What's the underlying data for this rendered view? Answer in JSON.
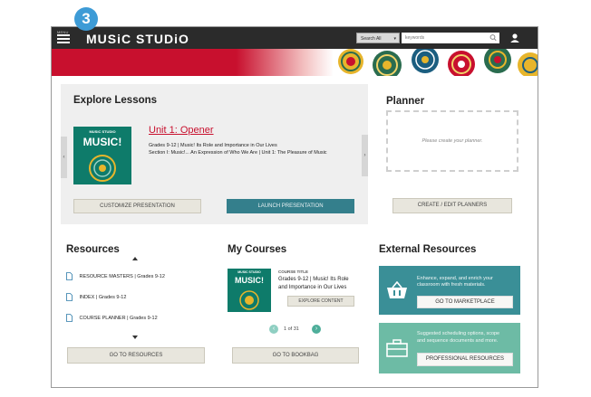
{
  "step_badge": "3",
  "header": {
    "menu_tiny_label": "MENU",
    "logo_text": "MUSiC STUDiO",
    "search_scope": "Search All",
    "search_placeholder": "keywords"
  },
  "explore": {
    "title": "Explore Lessons",
    "cover": {
      "brand": "MUSIC STUDIO",
      "title": "MUSIC!"
    },
    "unit_title": "Unit 1: Opener",
    "line1": "Grades 9-12 | Music! Its Role and Importance in Our Lives",
    "line2": "Section I: Music!... An Expression of Who We Are | Unit 1: The Pleasure of Music",
    "customize_label": "CUSTOMIZE PRESENTATION",
    "launch_label": "LAUNCH PRESENTATION",
    "prev_glyph": "‹",
    "next_glyph": "›"
  },
  "planner": {
    "title": "Planner",
    "placeholder": "Please create your planner.",
    "create_label": "CREATE / EDIT PLANNERS"
  },
  "resources": {
    "title": "Resources",
    "items": [
      {
        "label": "RESOURCE MASTERS | Grades 9-12"
      },
      {
        "label": "INDEX | Grades 9-12"
      },
      {
        "label": "COURSE PLANNER | Grades 9-12"
      }
    ],
    "button_label": "GO TO RESOURCES"
  },
  "courses": {
    "title": "My Courses",
    "cover": {
      "brand": "MUSIC STUDIO",
      "title": "MUSIC!"
    },
    "course_label": "COURSE TITLE",
    "course_name_line1": "Grades 9-12 | Music! Its Role",
    "course_name_line2": "and Importance in Our Lives",
    "explore_label": "EXPLORE CONTENT",
    "page_current": "1",
    "page_of": "of",
    "page_total": "31",
    "button_label": "GO TO BOOKBAG"
  },
  "external": {
    "title": "External Resources",
    "card1": {
      "line1": "Enhance, expand, and enrich your",
      "line2": "classroom with fresh materials.",
      "button": "GO TO MARKETPLACE",
      "color": "#3a8f97"
    },
    "card2": {
      "line1": "Suggested scheduling options, scope",
      "line2": "and sequence documents and more.",
      "button": "PROFESSIONAL RESOURCES",
      "color": "#6dbba5"
    }
  },
  "colors": {
    "brand_red": "#c8102e",
    "teal_button": "#347f8c",
    "top_bar": "#2b2b2b"
  }
}
